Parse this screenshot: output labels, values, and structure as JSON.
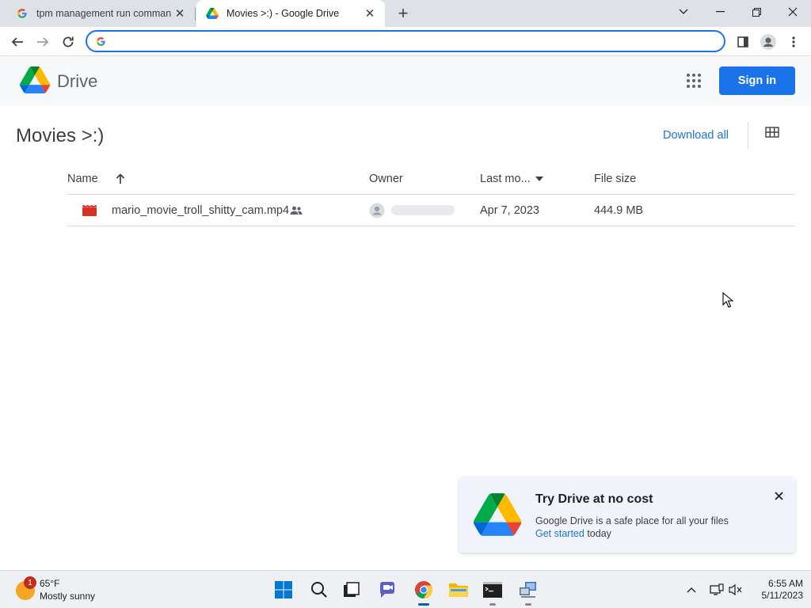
{
  "browser": {
    "tabs": [
      {
        "title": "tpm management run command",
        "active": false
      },
      {
        "title": "Movies >:) - Google Drive",
        "active": true
      }
    ],
    "address_value": "",
    "window_controls": [
      "chevron-down-icon",
      "minimize-icon",
      "restore-icon",
      "close-icon"
    ]
  },
  "drive": {
    "app_name": "Drive",
    "signin_label": "Sign in",
    "folder_title": "Movies >:)",
    "download_all_label": "Download all",
    "columns": {
      "name": "Name",
      "owner": "Owner",
      "last_modified": "Last mo...",
      "file_size": "File size"
    },
    "files": [
      {
        "name": "mario_movie_troll_shitty_cam.mp4",
        "owner": "",
        "modified": "Apr 7, 2023",
        "size": "444.9 MB",
        "shared": true
      }
    ]
  },
  "promo": {
    "title": "Try Drive at no cost",
    "body": "Google Drive is a safe place for all your files",
    "link": "Get started",
    "link_suffix": " today"
  },
  "taskbar": {
    "weather": {
      "temp": "65°F",
      "condition": "Mostly sunny",
      "badge": "1"
    },
    "apps": [
      "start-icon",
      "search-icon",
      "task-view-icon",
      "chat-icon",
      "chrome-icon",
      "file-explorer-icon",
      "terminal-icon",
      "network-app-icon"
    ],
    "clock_time": "6:55 AM",
    "clock_date": "5/11/2023"
  },
  "colors": {
    "accent": "#1a73e8",
    "drive_green": "#0f9d58",
    "drive_yellow": "#ffba00",
    "drive_blue": "#4285f4",
    "video_red": "#d93025"
  }
}
